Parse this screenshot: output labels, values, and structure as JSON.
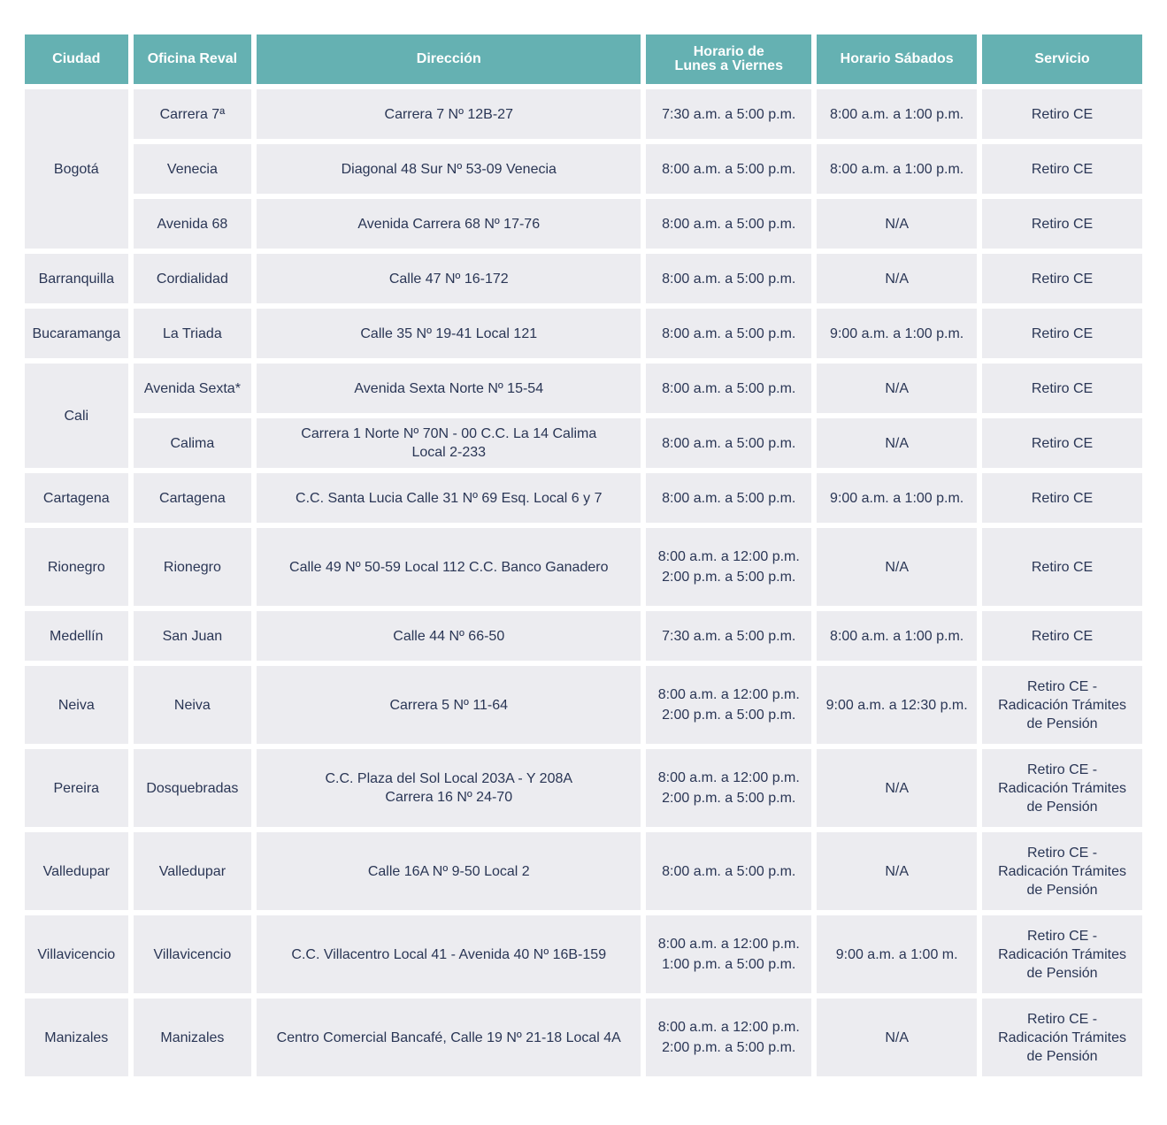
{
  "headers": {
    "ciudad": "Ciudad",
    "oficina": "Oficina Reval",
    "direccion": "Dirección",
    "horario_lv_1": "Horario de",
    "horario_lv_2": "Lunes a Viernes",
    "horario_sab": "Horario Sábados",
    "servicio": "Servicio"
  },
  "rows": [
    {
      "ciudad": "Bogotá",
      "oficina": "Carrera 7ª",
      "direccion": [
        "Carrera 7 Nº 12B-27"
      ],
      "lv": [
        "7:30 a.m. a 5:00 p.m."
      ],
      "sab": "8:00 a.m. a 1:00 p.m.",
      "servicio": [
        "Retiro CE"
      ]
    },
    {
      "oficina": "Venecia",
      "direccion": [
        "Diagonal 48 Sur Nº 53-09 Venecia"
      ],
      "lv": [
        "8:00 a.m. a 5:00 p.m."
      ],
      "sab": "8:00 a.m. a 1:00 p.m.",
      "servicio": [
        "Retiro CE"
      ]
    },
    {
      "oficina": "Avenida 68",
      "direccion": [
        "Avenida Carrera 68 Nº 17-76"
      ],
      "lv": [
        "8:00 a.m. a 5:00 p.m."
      ],
      "sab": "N/A",
      "servicio": [
        "Retiro CE"
      ]
    },
    {
      "ciudad": "Barranquilla",
      "oficina": "Cordialidad",
      "direccion": [
        "Calle 47 Nº 16-172"
      ],
      "lv": [
        "8:00 a.m. a 5:00 p.m."
      ],
      "sab": "N/A",
      "servicio": [
        "Retiro CE"
      ]
    },
    {
      "ciudad": "Bucaramanga",
      "oficina": "La Triada",
      "direccion": [
        "Calle 35 Nº 19-41 Local 121"
      ],
      "lv": [
        "8:00 a.m. a 5:00 p.m."
      ],
      "sab": "9:00 a.m. a 1:00 p.m.",
      "servicio": [
        "Retiro CE"
      ]
    },
    {
      "ciudad": "Cali",
      "oficina": "Avenida Sexta*",
      "direccion": [
        "Avenida Sexta Norte Nº 15-54"
      ],
      "lv": [
        "8:00 a.m. a 5:00 p.m."
      ],
      "sab": "N/A",
      "servicio": [
        "Retiro CE"
      ]
    },
    {
      "oficina": "Calima",
      "direccion": [
        "Carrera 1 Norte Nº 70N - 00 C.C. La 14 Calima",
        "Local 2-233"
      ],
      "lv": [
        "8:00 a.m. a 5:00 p.m."
      ],
      "sab": "N/A",
      "servicio": [
        "Retiro CE"
      ]
    },
    {
      "ciudad": "Cartagena",
      "oficina": "Cartagena",
      "direccion": [
        "C.C. Santa Lucia Calle 31 Nº 69 Esq. Local 6 y 7"
      ],
      "lv": [
        "8:00 a.m. a 5:00 p.m."
      ],
      "sab": "9:00 a.m. a 1:00 p.m.",
      "servicio": [
        "Retiro CE"
      ]
    },
    {
      "ciudad": "Rionegro",
      "oficina": "Rionegro",
      "direccion": [
        "Calle 49 Nº 50-59 Local 112 C.C. Banco Ganadero"
      ],
      "lv": [
        "8:00 a.m. a 12:00 p.m.",
        "2:00 p.m. a 5:00 p.m."
      ],
      "sab": "N/A",
      "servicio": [
        "Retiro CE"
      ]
    },
    {
      "ciudad": "Medellín",
      "oficina": "San Juan",
      "direccion": [
        "Calle 44 Nº 66-50"
      ],
      "lv": [
        "7:30 a.m. a 5:00 p.m."
      ],
      "sab": "8:00 a.m. a 1:00 p.m.",
      "servicio": [
        "Retiro CE"
      ]
    },
    {
      "ciudad": "Neiva",
      "oficina": "Neiva",
      "direccion": [
        "Carrera 5 Nº 11-64"
      ],
      "lv": [
        "8:00 a.m. a 12:00 p.m.",
        "2:00 p.m. a 5:00 p.m."
      ],
      "sab": "9:00 a.m. a 12:30 p.m.",
      "servicio": [
        "Retiro CE -",
        "Radicación Trámites",
        "de Pensión"
      ]
    },
    {
      "ciudad": "Pereira",
      "oficina": "Dosquebradas",
      "direccion": [
        "C.C. Plaza del Sol Local 203A - Y 208A",
        "Carrera 16 Nº 24-70"
      ],
      "lv": [
        "8:00 a.m. a 12:00 p.m.",
        "2:00 p.m. a 5:00 p.m."
      ],
      "sab": "N/A",
      "servicio": [
        "Retiro CE -",
        "Radicación Trámites",
        "de Pensión"
      ]
    },
    {
      "ciudad": "Valledupar",
      "oficina": "Valledupar",
      "direccion": [
        "Calle 16A Nº 9-50 Local 2"
      ],
      "lv": [
        "8:00 a.m. a 5:00 p.m."
      ],
      "sab": "N/A",
      "servicio": [
        "Retiro CE -",
        "Radicación Trámites",
        "de Pensión"
      ]
    },
    {
      "ciudad": "Villavicencio",
      "oficina": "Villavicencio",
      "direccion": [
        "C.C. Villacentro Local 41 - Avenida 40 Nº 16B-159"
      ],
      "lv": [
        "8:00 a.m. a 12:00 p.m.",
        "1:00 p.m. a 5:00 p.m."
      ],
      "sab": "9:00 a.m. a 1:00 m.",
      "servicio": [
        "Retiro CE -",
        "Radicación Trámites",
        "de Pensión"
      ]
    },
    {
      "ciudad": "Manizales",
      "oficina": "Manizales",
      "direccion": [
        "Centro Comercial Bancafé, Calle 19 Nº 21-18 Local 4A"
      ],
      "lv": [
        "8:00 a.m. a 12:00 p.m.",
        "2:00 p.m. a 5:00 p.m."
      ],
      "sab": "N/A",
      "servicio": [
        "Retiro CE -",
        "Radicación Trámites",
        "de Pensión"
      ]
    }
  ]
}
